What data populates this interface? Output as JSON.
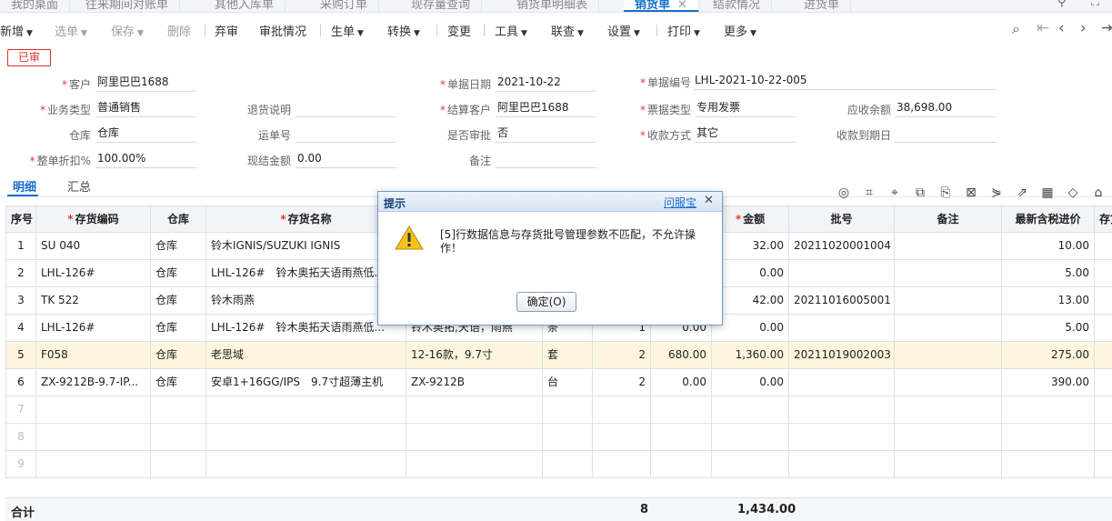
{
  "tabs": [
    {
      "label": "我的桌面"
    },
    {
      "label": "往来期间对账单"
    },
    {
      "label": "其他入库单"
    },
    {
      "label": "采购订单"
    },
    {
      "label": "现存量查询"
    },
    {
      "label": "销货单明细表"
    },
    {
      "label": "销货单",
      "close": "✕"
    },
    {
      "label": "结款情况"
    },
    {
      "label": "进货单"
    }
  ],
  "toolbar": {
    "add": "新增",
    "select": "选单",
    "save": "保存",
    "delete": "删除",
    "abandon": "弃审",
    "audit": "审批情况",
    "generate": "生单",
    "convert": "转换",
    "change": "变更",
    "tools": "工具",
    "query": "联查",
    "settings": "设置",
    "print": "打印",
    "more": "更多"
  },
  "stamp": "已审",
  "form": {
    "customer": {
      "label": "客户",
      "value": "阿里巴巴1688"
    },
    "date": {
      "label": "单据日期",
      "value": "2021-10-22"
    },
    "number": {
      "label": "单据编号",
      "value": "LHL-2021-10-22-005"
    },
    "biz_type": {
      "label": "业务类型",
      "value": "普通销售"
    },
    "return_note": {
      "label": "退货说明",
      "value": ""
    },
    "settle_customer": {
      "label": "结算客户",
      "value": "阿里巴巴1688"
    },
    "invoice_type": {
      "label": "票据类型",
      "value": "专用发票"
    },
    "receivable": {
      "label": "应收余额",
      "value": "38,698.00"
    },
    "warehouse": {
      "label": "仓库",
      "value": "仓库"
    },
    "waybill": {
      "label": "运单号",
      "value": ""
    },
    "approval": {
      "label": "是否审批",
      "value": "否"
    },
    "pay_method": {
      "label": "收款方式",
      "value": "其它"
    },
    "due_date": {
      "label": "收款到期日",
      "value": ""
    },
    "discount": {
      "label": "整单折扣%",
      "value": "100.00%"
    },
    "cash": {
      "label": "现结金额",
      "value": "0.00"
    },
    "remark": {
      "label": "备注",
      "value": ""
    }
  },
  "subtabs": {
    "detail": "明细",
    "summary": "汇总"
  },
  "grid": {
    "headers": {
      "idx": "序号",
      "code": "存货编码",
      "wh": "仓库",
      "name": "存货名称",
      "amount": "金额",
      "batch": "批号",
      "note": "备注",
      "price": "最新含税进价",
      "stock": "存货"
    },
    "rows": [
      {
        "idx": "1",
        "code": "SU 040",
        "wh": "仓库",
        "name": "铃木IGNIS/SUZUKI IGNIS",
        "spec": "",
        "unit": "",
        "qty": "",
        "uprice": "",
        "amount": "32.00",
        "batch": "20211020001004",
        "note": "",
        "price": "10.00"
      },
      {
        "idx": "2",
        "code": "LHL-126#",
        "wh": "仓库",
        "name": "LHL-126#　铃木奥拓天语雨燕低...",
        "spec": "",
        "unit": "",
        "qty": "",
        "uprice": "",
        "amount": "0.00",
        "batch": "",
        "note": "",
        "price": "5.00"
      },
      {
        "idx": "3",
        "code": "TK 522",
        "wh": "仓库",
        "name": "铃木雨燕",
        "spec": "",
        "unit": "",
        "qty": "",
        "uprice": "",
        "amount": "42.00",
        "batch": "20211016005001",
        "note": "",
        "price": "13.00"
      },
      {
        "idx": "4",
        "code": "LHL-126#",
        "wh": "仓库",
        "name": "LHL-126#　铃木奥拓天语雨燕低...",
        "spec": "铃木奥拓,天语，雨燕",
        "unit": "条",
        "qty": "1",
        "uprice": "0.00",
        "amount": "0.00",
        "batch": "",
        "note": "",
        "price": "5.00"
      },
      {
        "idx": "5",
        "code": "F058",
        "wh": "仓库",
        "name": "老思域",
        "spec": "12-16款，9.7寸",
        "unit": "套",
        "qty": "2",
        "uprice": "680.00",
        "amount": "1,360.00",
        "batch": "20211019002003",
        "note": "",
        "price": "275.00"
      },
      {
        "idx": "6",
        "code": "ZX-9212B-9.7-IP...",
        "wh": "仓库",
        "name": "安卓1+16GG/IPS　9.7寸超薄主机",
        "spec": "ZX-9212B",
        "unit": "台",
        "qty": "2",
        "uprice": "0.00",
        "amount": "0.00",
        "batch": "",
        "note": "",
        "price": "390.00"
      },
      {
        "idx": "7"
      },
      {
        "idx": "8"
      },
      {
        "idx": "9"
      }
    ]
  },
  "footer": {
    "label": "合计",
    "qty": "8",
    "amount": "1,434.00"
  },
  "dialog": {
    "title": "提示",
    "help_link": "问服宝",
    "close": "✕",
    "message": "[5]行数据信息与存货批号管理参数不匹配，不允许操作！",
    "ok": "确定(O)"
  }
}
